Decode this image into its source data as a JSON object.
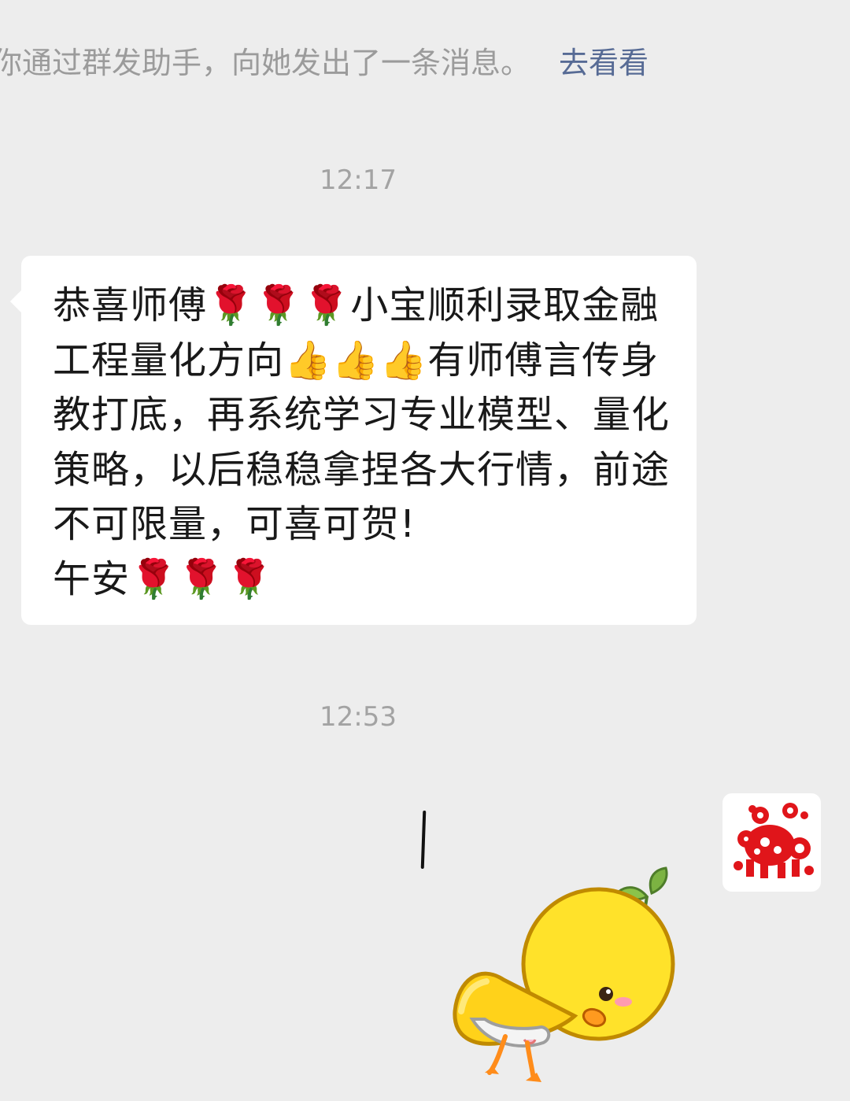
{
  "system_notice": {
    "text": "你通过群发助手，向她发出了一条消息。",
    "link": "去看看"
  },
  "timestamps": [
    "12:17",
    "12:53"
  ],
  "message": {
    "text": "恭喜师傅🌹🌹🌹小宝顺利录取金融工程量化方向👍👍👍有师傅言传身教打底，再系统学习专业模型、量化策略，以后稳稳拿捏各大行情，前途不可限量，可喜可贺!\n午安🌹🌹🌹"
  },
  "colors": {
    "background": "#ededed",
    "bubble": "#ffffff",
    "link": "#576b95",
    "avatar_papercut": "#e0151a",
    "chick_yellow": "#ffe22a"
  },
  "icons": {
    "avatar": "red-papercut-avatar",
    "sticker": "yellow-chick-bowing-sticker"
  }
}
